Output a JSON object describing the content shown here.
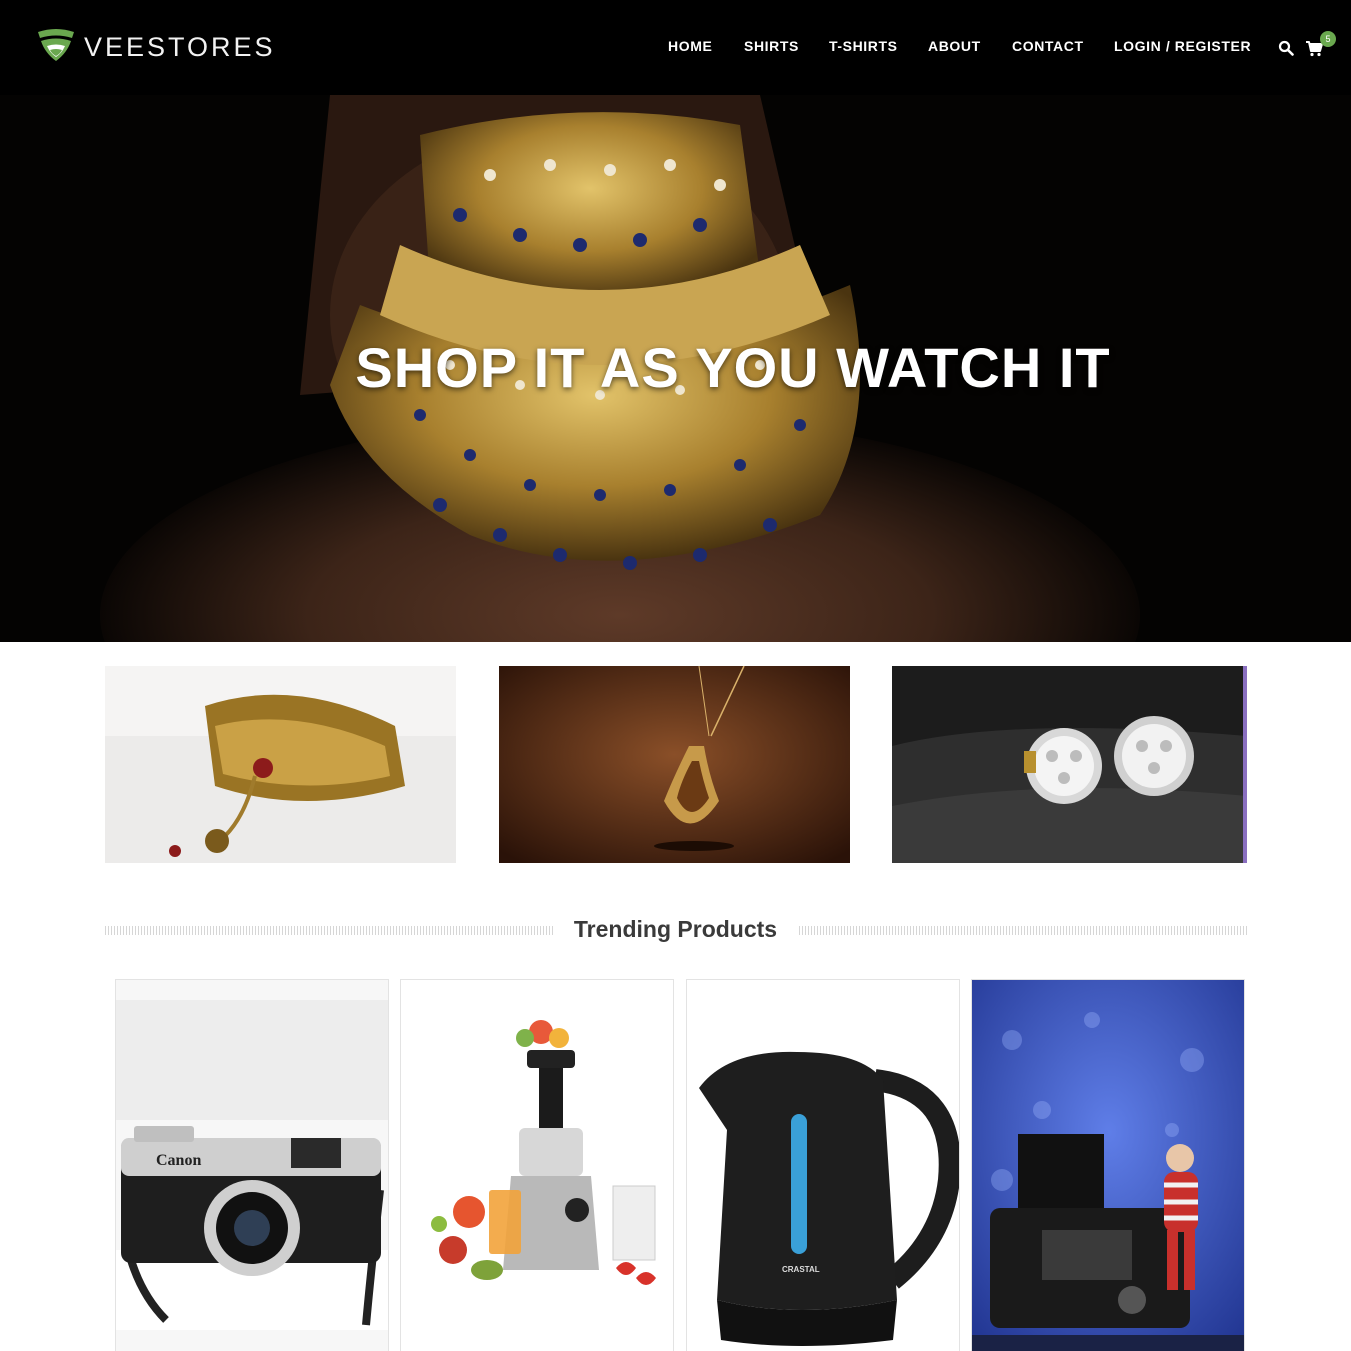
{
  "brand": {
    "name": "VEESTORES",
    "logo_icon": "shield-logo-icon"
  },
  "nav": {
    "items": [
      {
        "label": "HOME"
      },
      {
        "label": "SHIRTS"
      },
      {
        "label": "T-SHIRTS"
      },
      {
        "label": "ABOUT"
      },
      {
        "label": "CONTACT"
      },
      {
        "label": "LOGIN / REGISTER"
      }
    ],
    "search_icon": "search-icon",
    "cart_icon": "cart-icon",
    "cart_count": "5"
  },
  "hero": {
    "title": "SHOP IT AS YOU WATCH IT",
    "image": "gold choker necklace"
  },
  "categories": [
    {
      "image": "gold kundan choker necklace"
    },
    {
      "image": "gold teardrop pendant"
    },
    {
      "image": "diamond stud earrings"
    }
  ],
  "trending": {
    "title": "Trending Products",
    "products": [
      {
        "image": "vintage canon camera"
      },
      {
        "image": "juicer with fruits"
      },
      {
        "image": "black electric kettle"
      },
      {
        "image": "camera with knitted doll"
      }
    ]
  },
  "colors": {
    "header_bg": "#000000",
    "accent_green": "#6aa84f",
    "text_dark": "#3a3a3a"
  }
}
